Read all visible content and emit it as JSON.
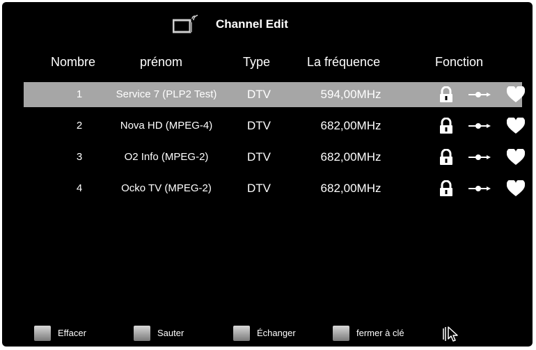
{
  "header": {
    "title": "Channel Edit",
    "icon": "tv-icon"
  },
  "columns": [
    "Nombre",
    "prénom",
    "Type",
    "La fréquence",
    "Fonction"
  ],
  "channels": [
    {
      "number": "1",
      "name": "Service 7 (PLP2 Test)",
      "type": "DTV",
      "frequency": "594,00MHz",
      "selected": true
    },
    {
      "number": "2",
      "name": "Nova HD (MPEG-4)",
      "type": "DTV",
      "frequency": "682,00MHz",
      "selected": false
    },
    {
      "number": "3",
      "name": "O2 Info (MPEG-2)",
      "type": "DTV",
      "frequency": "682,00MHz",
      "selected": false
    },
    {
      "number": "4",
      "name": "Ocko TV (MPEG-2)",
      "type": "DTV",
      "frequency": "682,00MHz",
      "selected": false
    }
  ],
  "function_icons": [
    "lock-icon",
    "move-arrow-icon",
    "heart-icon"
  ],
  "footer": {
    "delete_label": "Effacer",
    "skip_label": "Sauter",
    "swap_label": "Échanger",
    "lock_label": "fermer à clé",
    "cursor_icon": "pointer-cursor-icon"
  },
  "colors": {
    "background": "#000000",
    "selected_row": "#a6a6a6",
    "text": "#ffffff"
  }
}
